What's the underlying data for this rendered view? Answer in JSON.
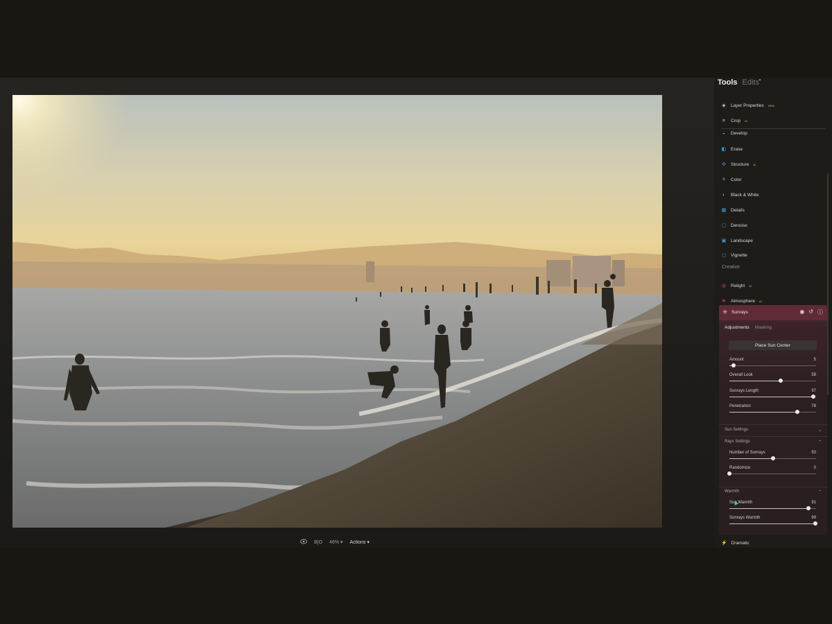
{
  "panel": {
    "tabs": {
      "tools": "Tools",
      "edits": "Edits",
      "edits_badge": "•"
    },
    "tools": [
      {
        "label": "Layer Properties",
        "badge": "NEW",
        "icon": "layers-icon",
        "color": "#cfd3d8"
      },
      {
        "label": "Crop",
        "badge": "AI",
        "icon": "crop-icon",
        "color": "#cfd3d8"
      },
      {
        "label": "Develop",
        "badge": "",
        "icon": "develop-icon",
        "color": "#3aa0e6"
      },
      {
        "label": "Erase",
        "badge": "",
        "icon": "erase-icon",
        "color": "#3aa0e6"
      },
      {
        "label": "Structure",
        "badge": "AI",
        "icon": "structure-icon",
        "color": "#3aa0e6"
      },
      {
        "label": "Color",
        "badge": "",
        "icon": "color-icon",
        "color": "#3aa0e6"
      },
      {
        "label": "Black & White",
        "badge": "",
        "icon": "black-white-icon",
        "color": "#3aa0e6"
      },
      {
        "label": "Details",
        "badge": "",
        "icon": "details-icon",
        "color": "#3aa0e6"
      },
      {
        "label": "Denoise",
        "badge": "",
        "icon": "denoise-icon",
        "color": "#3aa0e6"
      },
      {
        "label": "Landscape",
        "badge": "",
        "icon": "landscape-icon",
        "color": "#3aa0e6"
      },
      {
        "label": "Vignette",
        "badge": "",
        "icon": "vignette-icon",
        "color": "#3aa0e6"
      }
    ],
    "creative_section": "Creative",
    "creative_tools": [
      {
        "label": "Relight",
        "badge": "AI",
        "icon": "relight-icon",
        "color": "#d94a9a"
      },
      {
        "label": "Atmosphere",
        "badge": "AI",
        "icon": "atmosphere-icon",
        "color": "#d94a9a"
      }
    ],
    "sunrays": {
      "title": "Sunrays",
      "tab_adjustments": "Adjustments",
      "tab_masking": "Masking",
      "place_button": "Place Sun Center",
      "sliders": [
        {
          "label": "Amount",
          "value": "5",
          "level": 0.05
        },
        {
          "label": "Overall Look",
          "value": "59",
          "level": 0.59
        },
        {
          "label": "Sunrays Length",
          "value": "97",
          "level": 0.97
        },
        {
          "label": "Penetration",
          "value": "78",
          "level": 0.78
        }
      ],
      "sun_settings": "Sun Settings",
      "rays_settings": "Rays Settings",
      "rays_sliders": [
        {
          "label": "Number of Sunrays",
          "value": "50",
          "level": 0.5
        },
        {
          "label": "Randomize",
          "value": "0",
          "level": 0.0
        }
      ],
      "warmth": "Warmth",
      "warmth_sliders": [
        {
          "label": "Sun Warmth",
          "value": "91",
          "level": 0.91
        },
        {
          "label": "Sunrays Warmth",
          "value": "99",
          "level": 0.99
        }
      ]
    },
    "dramatic": "Dramatic"
  },
  "bottombar": {
    "compare": "B|O",
    "zoom": "46%",
    "actions": "Actions"
  },
  "colors": {
    "accent_sunrays": "#5e2b37",
    "tool_blue": "#3aa0e6",
    "creative_pink": "#d94a9a"
  }
}
